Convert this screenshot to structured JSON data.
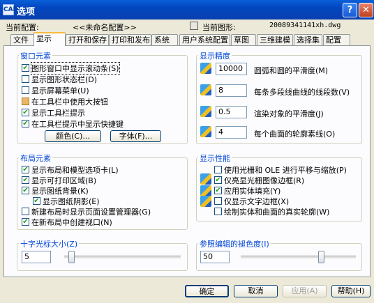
{
  "window": {
    "title": "选项",
    "app_icon": "CAD"
  },
  "header": {
    "profile_label": "当前配置:",
    "profile_value": "<<未命名配置>>",
    "drawing_label": "当前图形:",
    "drawing_value": "20089341141xh.dwg"
  },
  "tabs": [
    {
      "label": "文件"
    },
    {
      "label": "显示"
    },
    {
      "label": "打开和保存"
    },
    {
      "label": "打印和发布"
    },
    {
      "label": "系统"
    },
    {
      "label": "用户系统配置"
    },
    {
      "label": "草图"
    },
    {
      "label": "三维建模"
    },
    {
      "label": "选择集"
    },
    {
      "label": "配置"
    }
  ],
  "window_elements": {
    "title": "窗口元素",
    "items": [
      {
        "label": "图形窗口中显示滚动条(S)",
        "checked": true
      },
      {
        "label": "显示图形状态栏(D)",
        "checked": false
      },
      {
        "label": "显示屏幕菜单(U)",
        "checked": false
      },
      {
        "label": "在工具栏中使用大按钮",
        "checked": false
      },
      {
        "label": "显示工具栏提示",
        "checked": true
      },
      {
        "label": "在工具栏提示中显示快捷键",
        "checked": true
      }
    ],
    "color_button": "颜色(C)...",
    "font_button": "字体(F)..."
  },
  "layout_elements": {
    "title": "布局元素",
    "items": [
      {
        "label": "显示布局和模型选项卡(L)",
        "checked": true
      },
      {
        "label": "显示可打印区域(B)",
        "checked": true
      },
      {
        "label": "显示图纸背景(K)",
        "checked": true
      },
      {
        "label": "显示图纸阴影(E)",
        "checked": true
      },
      {
        "label": "新建布局时显示页面设置管理器(G)",
        "checked": false
      },
      {
        "label": "在新布局中创建视口(N)",
        "checked": true
      }
    ]
  },
  "crosshair": {
    "title": "十字光标大小(Z)",
    "value": "5",
    "level": 5
  },
  "display_resolution": {
    "title": "显示精度",
    "items": [
      {
        "value": "10000",
        "label": "圆弧和圆的平滑度(M)"
      },
      {
        "value": "8",
        "label": "每条多段线曲线的线段数(V)"
      },
      {
        "value": "0.5",
        "label": "渲染对象的平滑度(J)"
      },
      {
        "value": "4",
        "label": "每个曲面的轮廓素线(O)"
      }
    ]
  },
  "display_performance": {
    "title": "显示性能",
    "items": [
      {
        "label": "使用光栅和 OLE 进行平移与缩放(P)",
        "checked": false
      },
      {
        "label": "仅亮显光栅图像边框(R)",
        "checked": true
      },
      {
        "label": "应用实体填充(Y)",
        "checked": true
      },
      {
        "label": "仅显示文字边框(X)",
        "checked": false
      },
      {
        "label": "绘制实体和曲面的真实轮廓(W)",
        "checked": false
      }
    ]
  },
  "xref_fade": {
    "title": "参照编辑的褪色度(I)",
    "value": "50",
    "level": 50
  },
  "footer": {
    "ok": "确定",
    "cancel": "取消",
    "apply": "应用(A)",
    "help": "帮助(H)"
  },
  "icons": {
    "check": "✔",
    "help": "?",
    "close": "✕"
  }
}
